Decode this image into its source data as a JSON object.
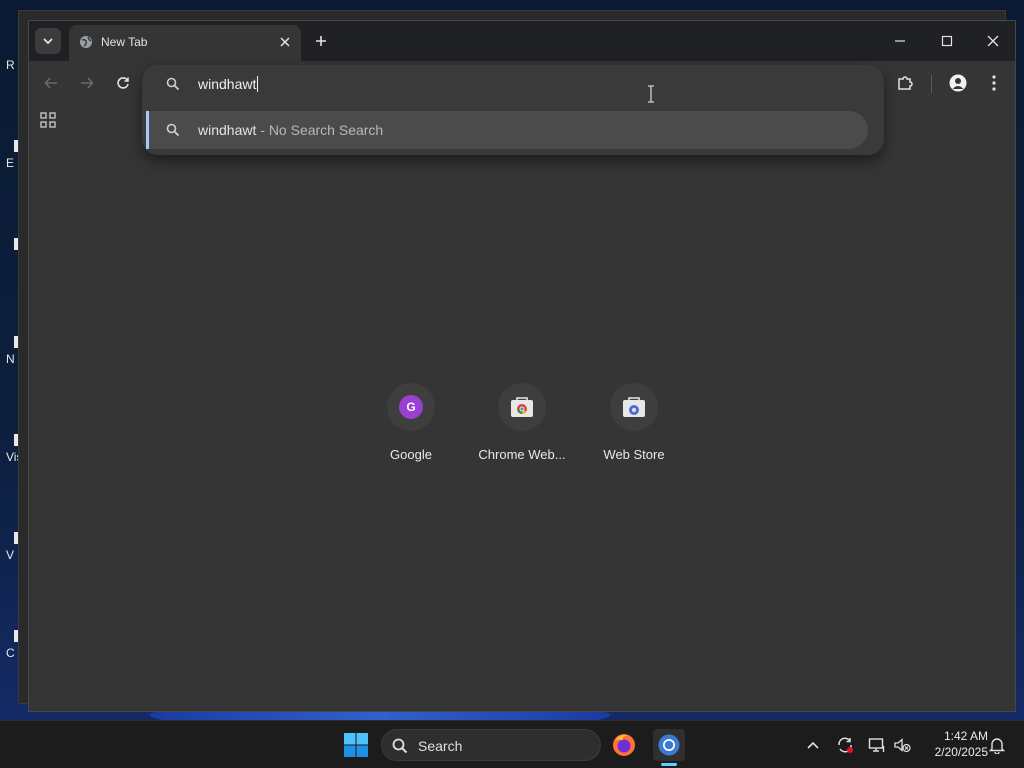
{
  "desktop": {
    "icon_labels": [
      "R",
      "E",
      "N",
      "Vis",
      "V",
      "C"
    ]
  },
  "browser": {
    "tab": {
      "title": "New Tab"
    },
    "omnibox": {
      "value": "windhawt",
      "suggestion": {
        "query": "windhawt",
        "description": " - No Search Search"
      }
    },
    "shortcuts": [
      {
        "label": "Google",
        "icon": "google-g-icon",
        "letter": "G"
      },
      {
        "label": "Chrome Web...",
        "icon": "chrome-web-store-icon"
      },
      {
        "label": "Web Store",
        "icon": "web-store-icon"
      }
    ]
  },
  "taskbar": {
    "search_label": "Search",
    "clock": {
      "time": "1:42 AM",
      "date": "2/20/2025"
    }
  },
  "colors": {
    "accent": "#a8c7fa",
    "taskbar_active": "#60cdff",
    "google_badge": "#9a3fd0"
  }
}
